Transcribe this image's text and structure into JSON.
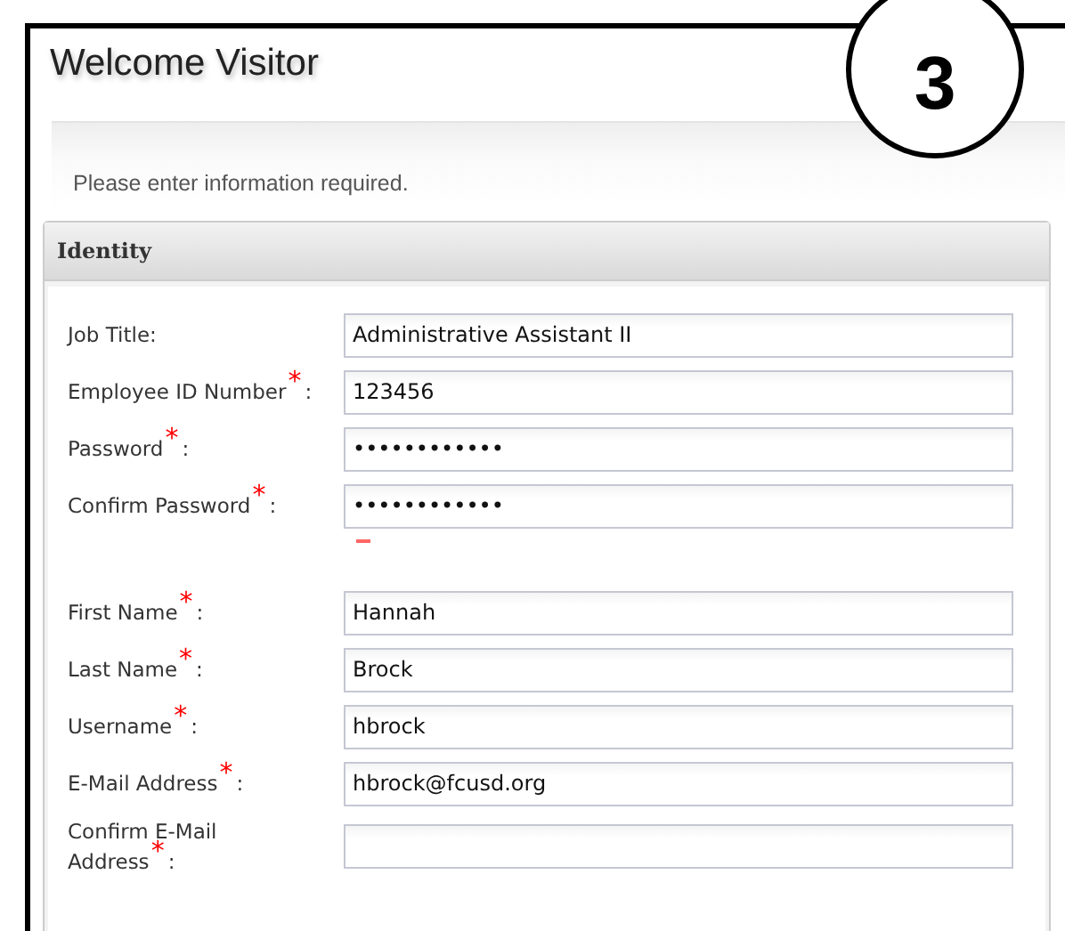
{
  "badge": "3",
  "title": "Welcome Visitor",
  "instruction": "Please enter information required.",
  "panel": {
    "title": "Identity",
    "groups": [
      [
        {
          "label": "Job Title:",
          "value": "Administrative Assistant II",
          "error": false
        },
        {
          "label": "Employee ID Number$^{*}$:",
          "value": "123456",
          "error": false
        },
        {
          "label": "Password$^{*}$:",
          "value": "••••••••••••",
          "error": false
        },
        {
          "label": "Confirm Password$^{*}$:",
          "value": "••••••••••••",
          "error": true
        }
      ],
      [
        {
          "label": "First Name$^{*}$:",
          "value": "Hannah",
          "error": false
        },
        {
          "label": "Last Name$^{*}$:",
          "value": "Brock",
          "error": false
        },
        {
          "label": "Username$^{*}$:",
          "value": "hbrock",
          "error": false
        },
        {
          "label": "E-Mail Address$^{*}$:",
          "value": "hbrock@fcusd.org",
          "error": false
        },
        {
          "label": "Confirm E-Mail Address$^{*}$:",
          "error": false
        }
      ]
    ]
  }
}
